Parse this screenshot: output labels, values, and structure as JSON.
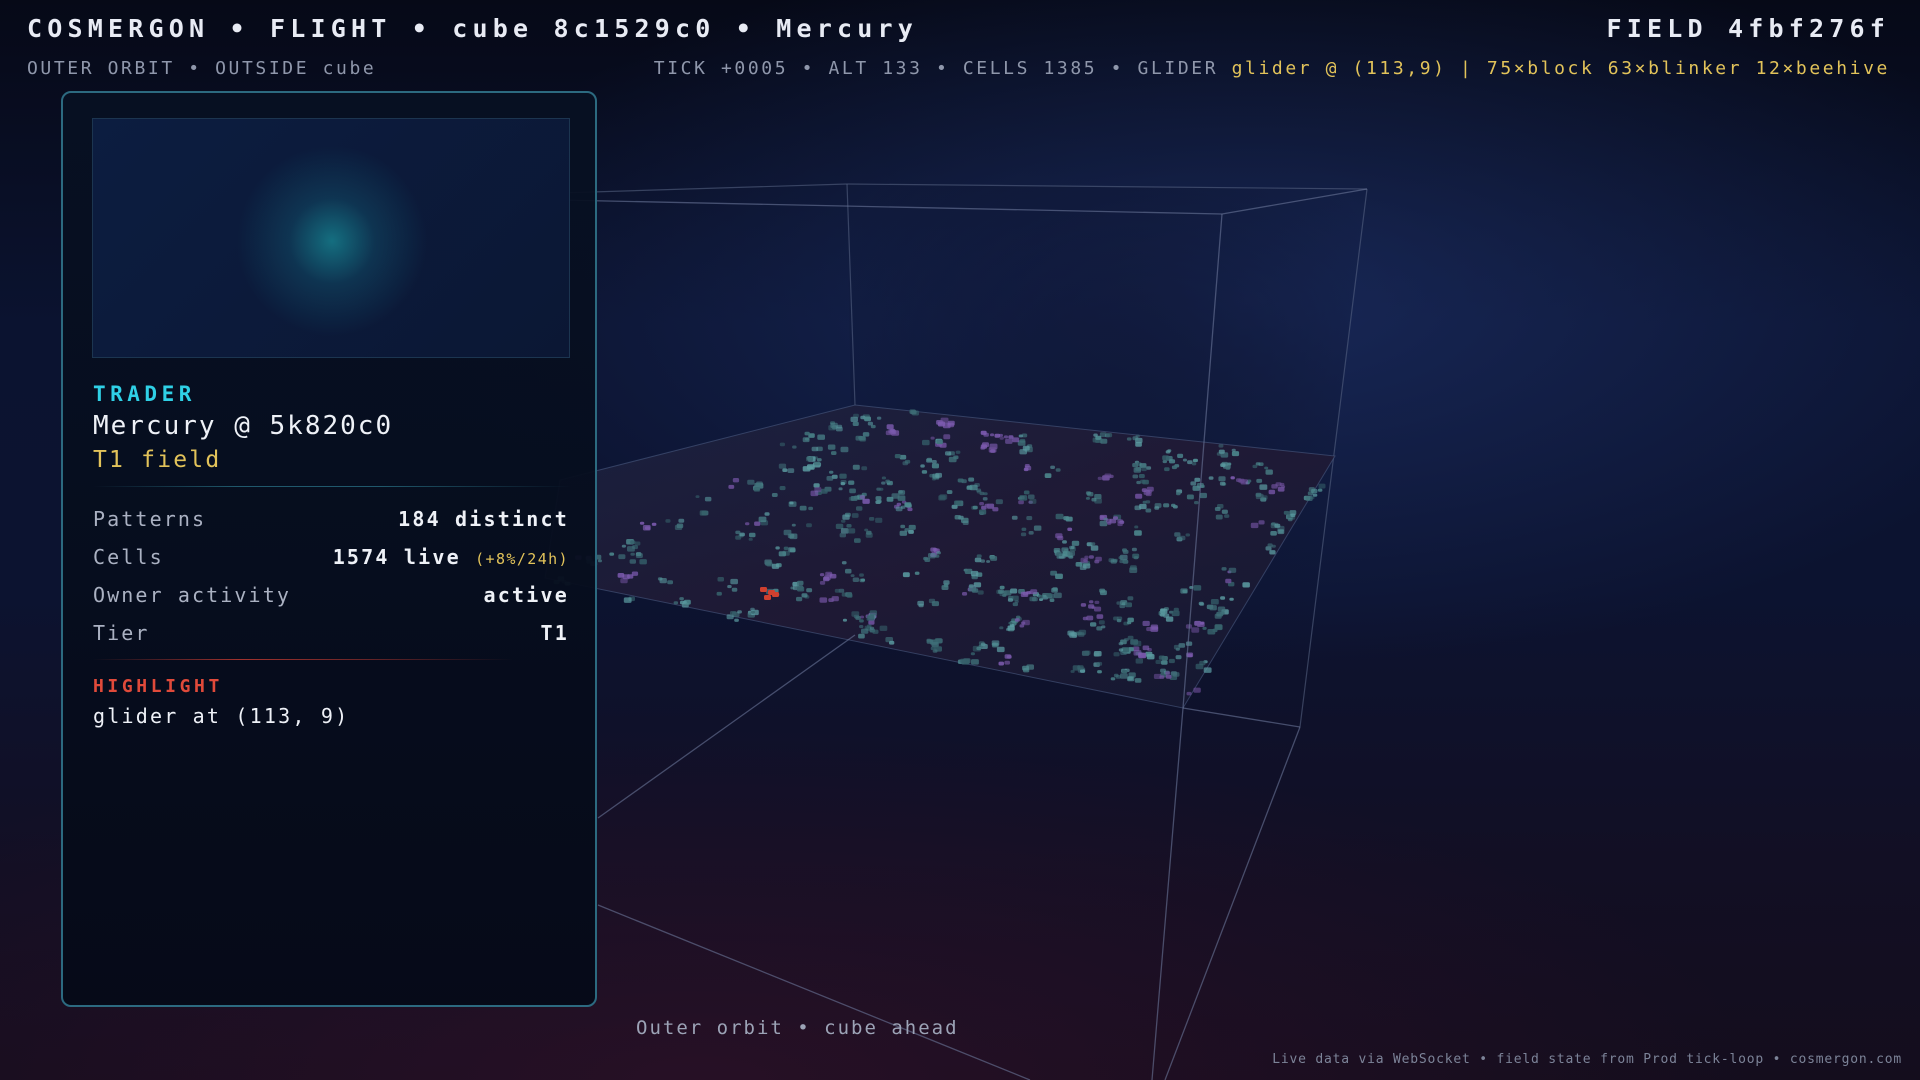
{
  "header": {
    "title": "COSMERGON • FLIGHT • cube 8c1529c0 • Mercury",
    "field": "FIELD 4fbf276f",
    "subtitle": "OUTER ORBIT • OUTSIDE cube",
    "status": "TICK +0005 • ALT 133 • CELLS 1385 • GLIDER",
    "status_highlight": "glider @ (113,9) | 75×block 63×blinker 12×beehive"
  },
  "panel": {
    "kind": "TRADER",
    "name": "Mercury @ 5k820c0",
    "tier_line": "T1 field",
    "stats": [
      {
        "label": "Patterns",
        "value": "184 distinct"
      },
      {
        "label": "Cells",
        "value": "1574 live",
        "delta": "(+8%/24h)"
      },
      {
        "label": "Owner activity",
        "value": "active"
      },
      {
        "label": "Tier",
        "value": "T1"
      }
    ],
    "highlight": {
      "title": "HIGHLIGHT",
      "text": "glider at (113, 9)"
    }
  },
  "caption": "Outer orbit • cube ahead",
  "footer": "Live data via WebSocket • field state from Prod tick-loop • cosmergon.com",
  "colors": {
    "accent_cyan": "#2fd0e6",
    "accent_yellow": "#e2c35a",
    "accent_red": "#e04a3a",
    "panel_border": "#2c6a80",
    "background": "#070a18"
  },
  "scene": {
    "kind": "wireframe-cube",
    "cell_clusters": [
      "teal",
      "purple",
      "red"
    ]
  }
}
